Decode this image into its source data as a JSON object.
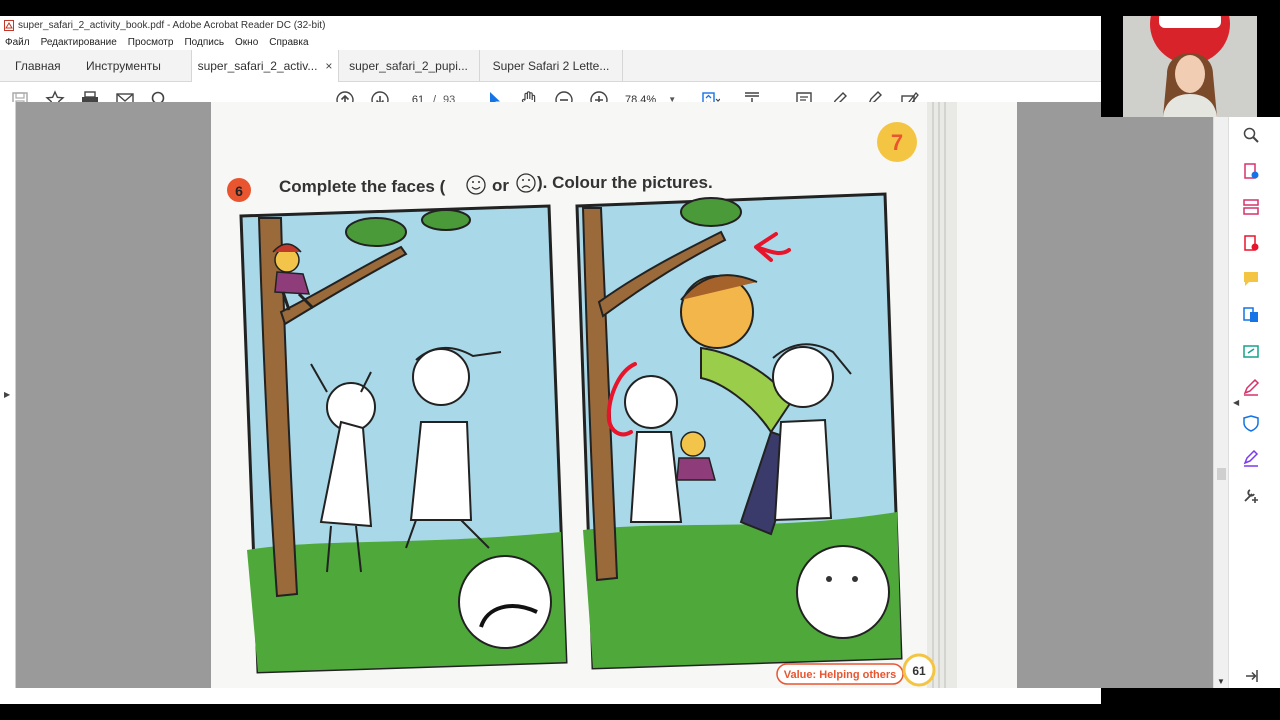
{
  "window": {
    "title": "super_safari_2_activity_book.pdf - Adobe Acrobat Reader DC (32-bit)"
  },
  "menu": [
    "Файл",
    "Редактирование",
    "Просмотр",
    "Подпись",
    "Окно",
    "Справка"
  ],
  "tabs": {
    "home": "Главная",
    "tools": "Инструменты",
    "docs": [
      {
        "label": "super_safari_2_activ...",
        "active": true
      },
      {
        "label": "super_safari_2_pupi...",
        "active": false
      },
      {
        "label": "Super Safari 2 Lette...",
        "active": false
      }
    ],
    "close_glyph": "×"
  },
  "toolbar": {
    "current_page": "61",
    "separator": "/",
    "total_pages": "93",
    "zoom": "78,4%",
    "icons": [
      "save-icon",
      "star-icon",
      "print-icon",
      "email-icon",
      "search-icon",
      "page-up-icon",
      "page-down-icon",
      "zoom-out-icon",
      "zoom-in-icon",
      "select-cursor-icon",
      "hand-icon",
      "fit-page-icon",
      "scroll-mode-icon",
      "comment-icon",
      "pen-icon",
      "sign-icon",
      "fill-sign-icon"
    ]
  },
  "document": {
    "unit_badge": "7",
    "exercise_number": "6",
    "instruction_part1": "Complete the faces (",
    "instruction_or": "or",
    "instruction_part2": "). Colour the pictures.",
    "value_label": "Value: Helping others",
    "page_number": "61"
  },
  "right_panel_icons": [
    "zoom-tool-icon",
    "create-pdf-icon",
    "organize-pages-icon",
    "export-pdf-icon",
    "comment-tool-icon",
    "convert-icon",
    "share-icon",
    "fill-sign-tool-icon",
    "protect-icon",
    "signature-icon",
    "more-tools-icon",
    "collapse-panel-icon"
  ],
  "colors": {
    "accent_blue": "#1473e6",
    "badge_orange": "#e8552f",
    "badge_yellow": "#f4c542",
    "sky": "#a9d9e8",
    "grass": "#4fa83a",
    "annotation_red": "#e8142b"
  }
}
